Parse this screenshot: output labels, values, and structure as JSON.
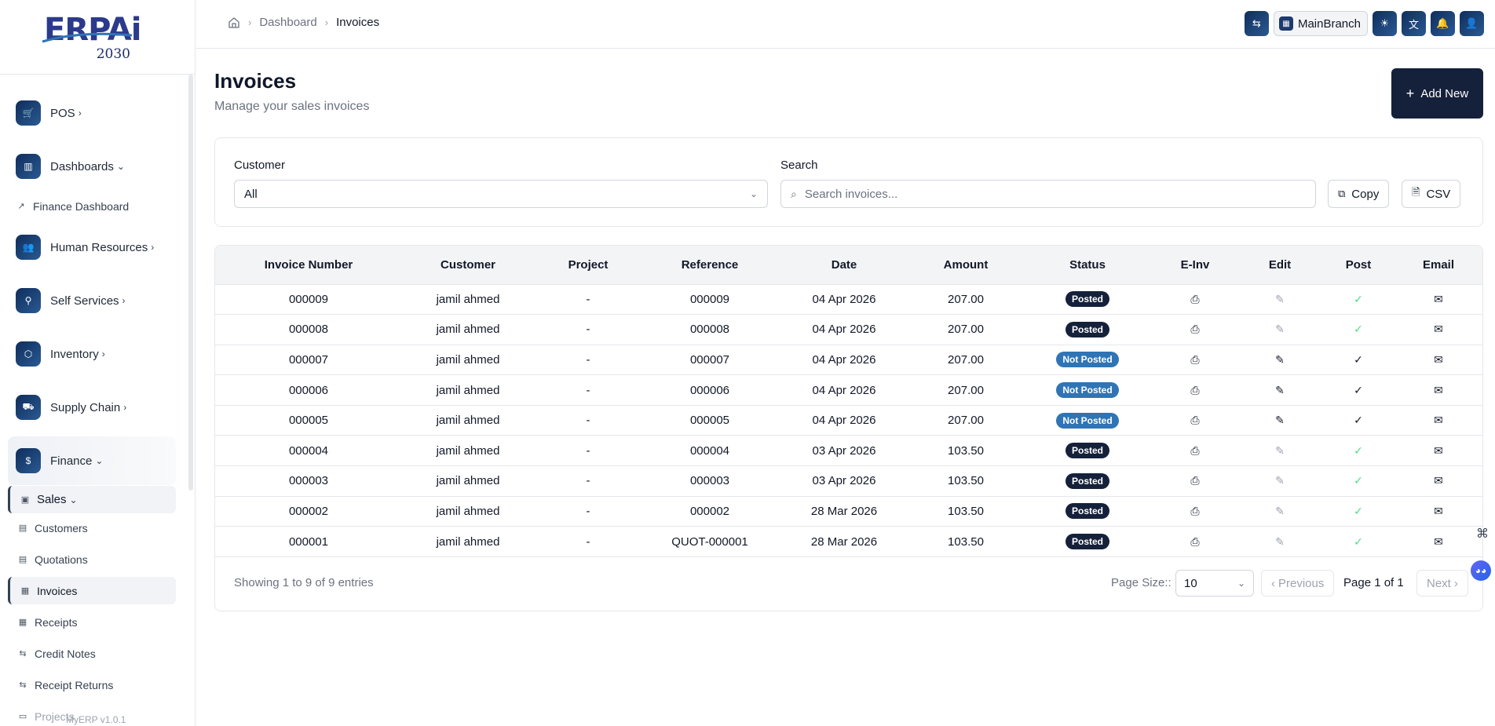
{
  "app": {
    "logo_text": "ERPAi",
    "logo_year": "2030",
    "version": "MyERP v1.0.1"
  },
  "sidebar": {
    "modules": [
      {
        "label": "POS",
        "chevron": "›",
        "icon": "🛒"
      },
      {
        "label": "Dashboards",
        "chevron": "⌄",
        "icon": "▥"
      },
      {
        "label": "Human Resources",
        "chevron": "›",
        "icon": "👥"
      },
      {
        "label": "Self Services",
        "chevron": "›",
        "icon": "⚲"
      },
      {
        "label": "Inventory",
        "chevron": "›",
        "icon": "⬡"
      },
      {
        "label": "Supply Chain",
        "chevron": "›",
        "icon": "⛟"
      },
      {
        "label": "Finance",
        "chevron": "⌄",
        "icon": "$"
      }
    ],
    "finance_dashboard": "Finance Dashboard",
    "sales": "Sales",
    "sales_items": [
      {
        "label": "Customers",
        "icon": "▤"
      },
      {
        "label": "Quotations",
        "icon": "▤"
      },
      {
        "label": "Invoices",
        "icon": "▦"
      },
      {
        "label": "Receipts",
        "icon": "▦"
      },
      {
        "label": "Credit Notes",
        "icon": "⇆"
      },
      {
        "label": "Receipt Returns",
        "icon": "⇆"
      },
      {
        "label": "Projects",
        "icon": "▭"
      }
    ]
  },
  "header": {
    "breadcrumb": [
      "Dashboard",
      "Invoices"
    ],
    "branch": "MainBranch"
  },
  "page": {
    "title": "Invoices",
    "subtitle": "Manage your sales invoices",
    "add_new": "Add New"
  },
  "filters": {
    "customer_label": "Customer",
    "customer_value": "All",
    "search_label": "Search",
    "search_placeholder": "Search invoices...",
    "copy": "Copy",
    "csv": "CSV"
  },
  "table": {
    "columns": [
      "Invoice Number",
      "Customer",
      "Project",
      "Reference",
      "Date",
      "Amount",
      "Status",
      "E-Inv",
      "Edit",
      "Post",
      "Email"
    ],
    "rows": [
      {
        "number": "000009",
        "customer": "jamil ahmed",
        "project": "-",
        "reference": "000009",
        "date": "04 Apr 2026",
        "amount": "207.00",
        "status": "Posted"
      },
      {
        "number": "000008",
        "customer": "jamil ahmed",
        "project": "-",
        "reference": "000008",
        "date": "04 Apr 2026",
        "amount": "207.00",
        "status": "Posted"
      },
      {
        "number": "000007",
        "customer": "jamil ahmed",
        "project": "-",
        "reference": "000007",
        "date": "04 Apr 2026",
        "amount": "207.00",
        "status": "Not Posted"
      },
      {
        "number": "000006",
        "customer": "jamil ahmed",
        "project": "-",
        "reference": "000006",
        "date": "04 Apr 2026",
        "amount": "207.00",
        "status": "Not Posted"
      },
      {
        "number": "000005",
        "customer": "jamil ahmed",
        "project": "-",
        "reference": "000005",
        "date": "04 Apr 2026",
        "amount": "207.00",
        "status": "Not Posted"
      },
      {
        "number": "000004",
        "customer": "jamil ahmed",
        "project": "-",
        "reference": "000004",
        "date": "03 Apr 2026",
        "amount": "103.50",
        "status": "Posted"
      },
      {
        "number": "000003",
        "customer": "jamil ahmed",
        "project": "-",
        "reference": "000003",
        "date": "03 Apr 2026",
        "amount": "103.50",
        "status": "Posted"
      },
      {
        "number": "000002",
        "customer": "jamil ahmed",
        "project": "-",
        "reference": "000002",
        "date": "28 Mar 2026",
        "amount": "103.50",
        "status": "Posted"
      },
      {
        "number": "000001",
        "customer": "jamil ahmed",
        "project": "-",
        "reference": "QUOT-000001",
        "date": "28 Mar 2026",
        "amount": "103.50",
        "status": "Posted"
      }
    ]
  },
  "pagination": {
    "showing": "Showing 1 to 9 of 9 entries",
    "page_size_label": "Page Size::",
    "page_size": "10",
    "previous": "Previous",
    "page_info": "Page 1 of 1",
    "next": "Next"
  },
  "colors": {
    "primary": "#15213b",
    "posted": "#15213b",
    "not_posted": "#2f74b5",
    "post_done": "#4ade80"
  }
}
